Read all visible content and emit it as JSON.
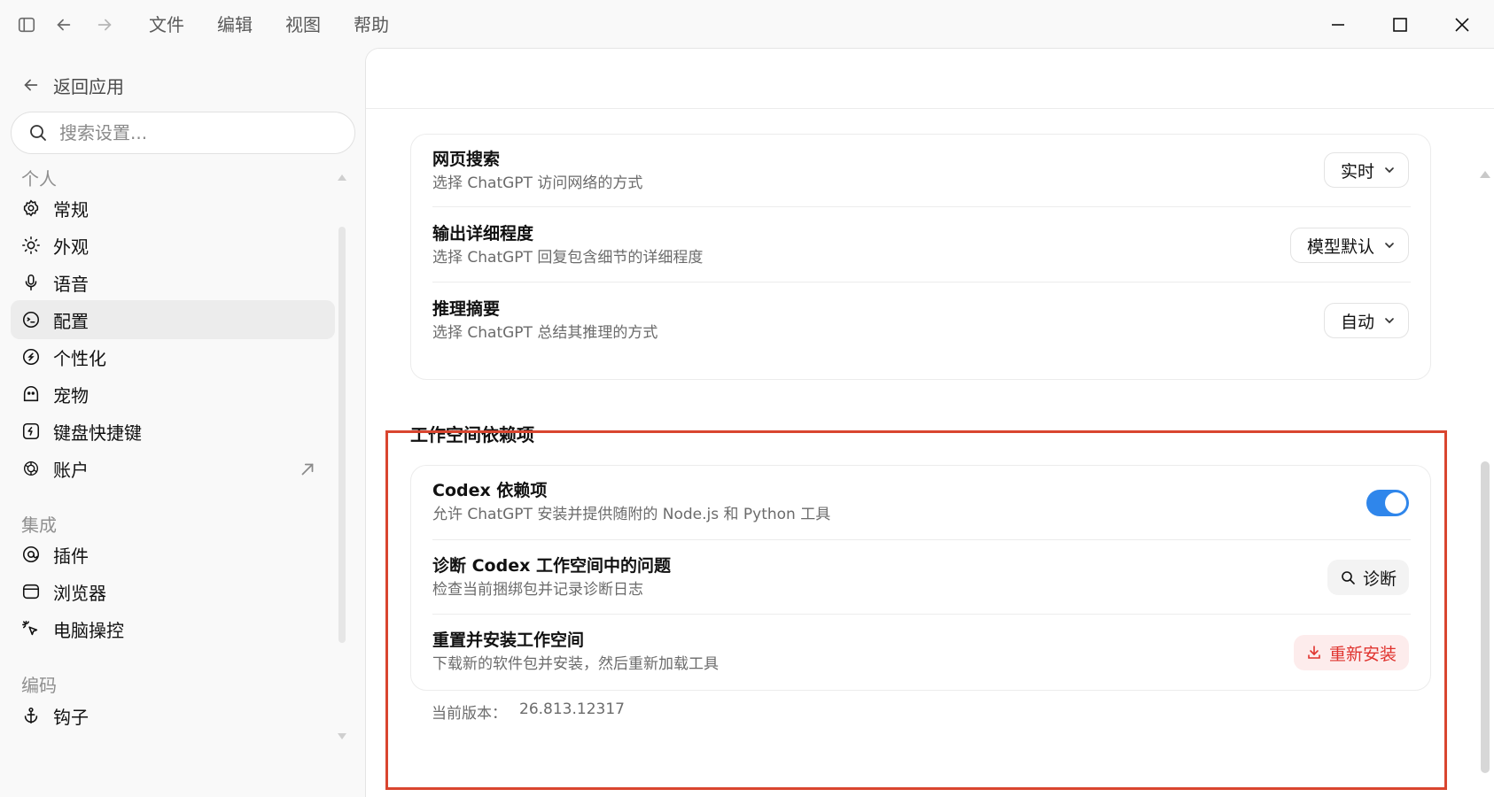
{
  "menu": [
    "文件",
    "编辑",
    "视图",
    "帮助"
  ],
  "sidebar": {
    "back_label": "返回应用",
    "search_placeholder": "搜索设置...",
    "sections": [
      {
        "label": "个人"
      },
      {
        "label": "集成"
      },
      {
        "label": "编码"
      }
    ],
    "items": [
      {
        "label": "常规",
        "icon": "gear-icon"
      },
      {
        "label": "外观",
        "icon": "sun-icon"
      },
      {
        "label": "语音",
        "icon": "microphone-icon"
      },
      {
        "label": "配置",
        "icon": "profile-icon",
        "active": true
      },
      {
        "label": "个性化",
        "icon": "personalize-icon"
      },
      {
        "label": "宠物",
        "icon": "pet-icon"
      },
      {
        "label": "键盘快捷键",
        "icon": "keyboard-icon"
      },
      {
        "label": "账户",
        "icon": "openai-icon",
        "external": true
      },
      {
        "label": "插件",
        "icon": "plugin-icon"
      },
      {
        "label": "浏览器",
        "icon": "browser-icon"
      },
      {
        "label": "电脑操控",
        "icon": "cursor-icon"
      },
      {
        "label": "钩子",
        "icon": "anchor-icon"
      }
    ]
  },
  "settings": {
    "web_search": {
      "title": "网页搜索",
      "subtitle": "选择 ChatGPT 访问网络的方式",
      "value": "实时"
    },
    "verbosity": {
      "title": "输出详细程度",
      "subtitle": "选择 ChatGPT 回复包含细节的详细程度",
      "value": "模型默认"
    },
    "reasoning": {
      "title": "推理摘要",
      "subtitle": "选择 ChatGPT 总结其推理的方式",
      "value": "自动"
    }
  },
  "workspace": {
    "title": "工作空间依赖项",
    "codex_deps": {
      "title": "Codex 依赖项",
      "subtitle": "允许 ChatGPT 安装并提供随附的 Node.js 和 Python 工具",
      "enabled": true
    },
    "diagnose": {
      "title": "诊断 Codex 工作空间中的问题",
      "subtitle": "检查当前捆绑包并记录诊断日志",
      "button": "诊断"
    },
    "reinstall": {
      "title": "重置并安装工作空间",
      "subtitle": "下载新的软件包并安装，然后重新加载工具",
      "button": "重新安装"
    },
    "version_label": "当前版本：",
    "version_value": "26.813.12317"
  },
  "colors": {
    "accent": "#2f86eb",
    "danger": "#e0332e",
    "highlight": "#d9452f"
  }
}
